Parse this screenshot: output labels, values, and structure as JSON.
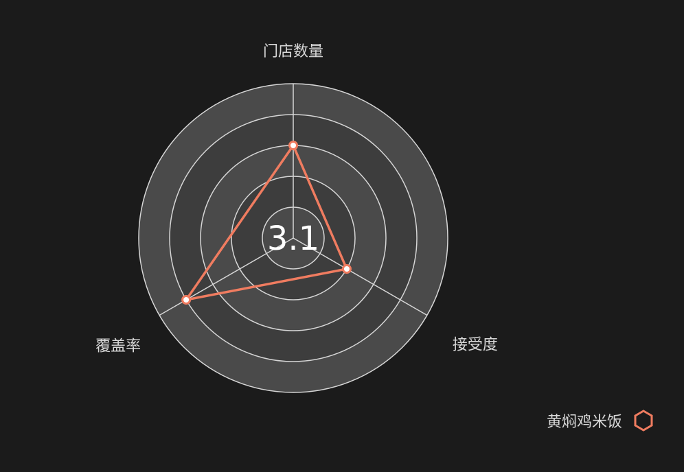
{
  "chart_data": {
    "type": "radar",
    "axes": [
      "门店数量",
      "接受度",
      "覆盖率"
    ],
    "rmax": 5,
    "ring_count": 5,
    "series": [
      {
        "name": "黄焖鸡米饭",
        "values": [
          3,
          2,
          4
        ],
        "color": "#f07c60"
      }
    ],
    "center_value": "3.1"
  },
  "theme": {
    "background": "#1b1b1b",
    "ring_dark": "#3d3d3d",
    "ring_light": "#4a4a4a",
    "grid_line": "#d6d6d6"
  },
  "legend": {
    "label": "黄焖鸡米饭",
    "icon": "hexagon-icon",
    "color": "#f07c60"
  }
}
